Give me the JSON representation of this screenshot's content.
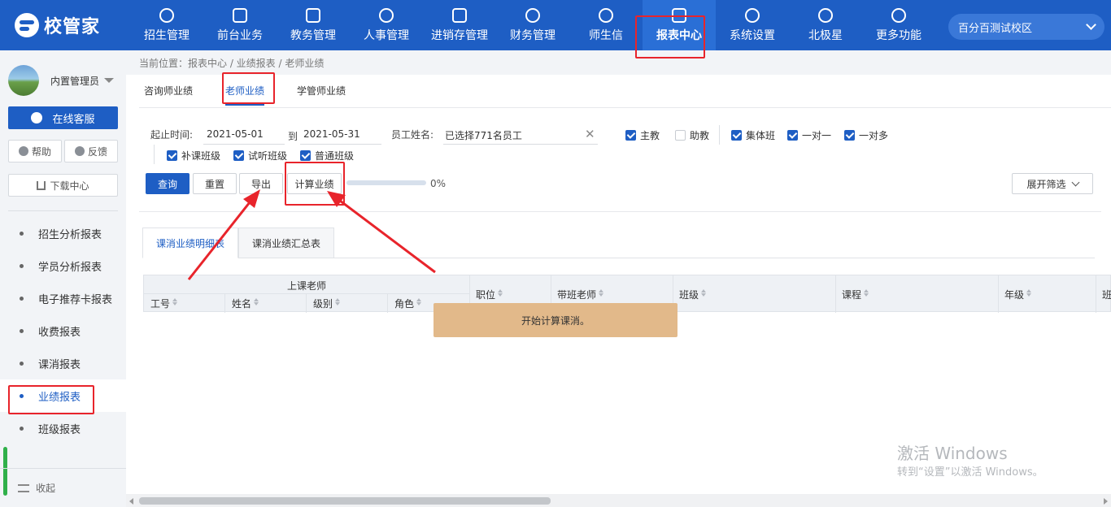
{
  "app": {
    "logo_text": "校管家"
  },
  "nav": [
    {
      "label": "招生管理",
      "icon": "user-add-icon"
    },
    {
      "label": "前台业务",
      "icon": "monitor-icon"
    },
    {
      "label": "教务管理",
      "icon": "book-icon"
    },
    {
      "label": "人事管理",
      "icon": "person-icon"
    },
    {
      "label": "进销存管理",
      "icon": "login-icon"
    },
    {
      "label": "财务管理",
      "icon": "finance-icon"
    },
    {
      "label": "师生信",
      "icon": "chat-icon"
    },
    {
      "label": "报表中心",
      "icon": "report-icon",
      "active": true
    },
    {
      "label": "系统设置",
      "icon": "gear-icon"
    },
    {
      "label": "北极星",
      "icon": "star-icon"
    },
    {
      "label": "更多功能",
      "icon": "more-icon"
    }
  ],
  "campus": {
    "name": "百分百测试校区"
  },
  "sidebar": {
    "user_name": "内置管理员",
    "service_label": "在线客服",
    "help_label": "帮助",
    "feedback_label": "反馈",
    "download_label": "下载中心",
    "menu": [
      "招生分析报表",
      "学员分析报表",
      "电子推荐卡报表",
      "收费报表",
      "课消报表",
      "业绩报表",
      "班级报表"
    ],
    "active_menu": "业绩报表",
    "collapse_label": "收起"
  },
  "breadcrumb": "当前位置：报表中心 / 业绩报表 / 老师业绩",
  "tabs": [
    "咨询师业绩",
    "老师业绩",
    "学管师业绩"
  ],
  "active_tab": "老师业绩",
  "filters": {
    "date_label": "起止时间:",
    "start_date": "2021-05-01",
    "to_label": "到",
    "end_date": "2021-05-31",
    "employee_label": "员工姓名:",
    "employee_value": "已选择771名员工",
    "checkboxes": [
      {
        "label": "主教",
        "checked": true
      },
      {
        "label": "助教",
        "checked": false
      },
      {
        "label": "集体班",
        "checked": true
      },
      {
        "label": "一对一",
        "checked": true
      },
      {
        "label": "一对多",
        "checked": true
      },
      {
        "label": "补课班级",
        "checked": true
      },
      {
        "label": "试听班级",
        "checked": true
      },
      {
        "label": "普通班级",
        "checked": true
      }
    ]
  },
  "actions": {
    "query": "查询",
    "reset": "重置",
    "export": "导出",
    "calculate": "计算业绩",
    "progress": 0,
    "progress_text": "0%",
    "expand_filter": "展开筛选"
  },
  "subtabs": [
    "课消业绩明细表",
    "课消业绩汇总表"
  ],
  "active_subtab": "课消业绩明细表",
  "table": {
    "group_header": "上课老师",
    "sub_headers": [
      "工号",
      "姓名",
      "级别",
      "角色"
    ],
    "headers": [
      "职位",
      "带班老师",
      "班级",
      "课程",
      "年级",
      "班"
    ]
  },
  "toast": "开始计算课消。",
  "watermark": {
    "line1": "激活 Windows",
    "line2": "转到“设置”以激活 Windows。"
  },
  "colors": {
    "primary": "#1e5ec4",
    "annotation": "#e8242b",
    "toast_bg": "#e2b98a"
  }
}
